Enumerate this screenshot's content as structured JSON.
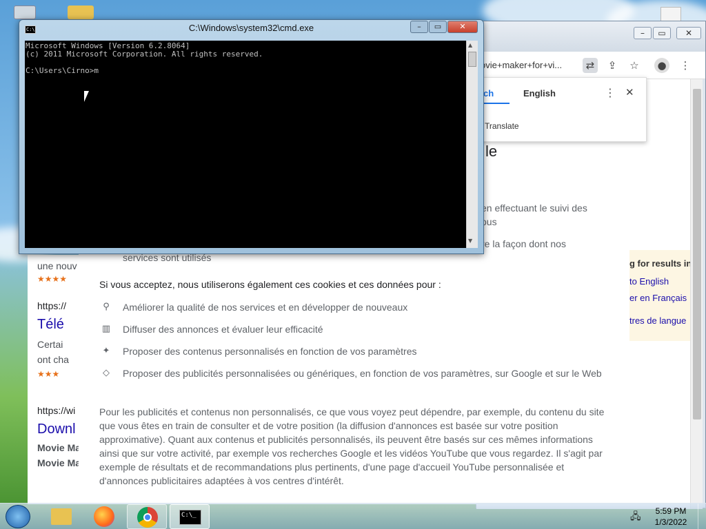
{
  "cmd": {
    "title": "C:\\Windows\\system32\\cmd.exe",
    "icon_text": "C:\\",
    "lines": [
      "Microsoft Windows [Version 6.2.8064]",
      "(c) 2011 Microsoft Corporation. All rights reserved.",
      "",
      "C:\\Users\\Cirno>m"
    ]
  },
  "chrome": {
    "omnibox_text": "ovie+maker+for+vi...",
    "translate_popup": {
      "tab_partial": "ch",
      "tab_active": "English",
      "translate_label": "Translate"
    }
  },
  "background_page": {
    "heading_partial": "le",
    "text_1": "en effectuant le suivi des",
    "text_2": "ous",
    "text_3": "re la façon dont nos",
    "services_line": "services sont utilisés",
    "right_panel": {
      "line_1": "g for results in",
      "line_2": "to English",
      "line_3": "er en Français",
      "line_4": "tres de langue"
    },
    "left_results": {
      "text_1": "une nouv",
      "stars_1": "★★★★",
      "url_1": "https://",
      "title_1": "Télé",
      "text_2": "Certai",
      "text_3": "ont cha",
      "stars_2": "★★★",
      "url_2": "https://wi",
      "title_2": "Downl",
      "bold_1": "Movie Ma",
      "bold_2": "Movie Ma"
    }
  },
  "consent": {
    "intro": "Si vous acceptez, nous utiliserons également ces cookies et ces données pour :",
    "items": [
      {
        "icon": "search-icon",
        "text": "Améliorer la qualité de nos services et en développer de nouveaux"
      },
      {
        "icon": "chart-icon",
        "text": "Diffuser des annonces et évaluer leur efficacité"
      },
      {
        "icon": "sparkle-icon",
        "text": "Proposer des contenus personnalisés en fonction de vos paramètres"
      },
      {
        "icon": "tag-icon",
        "text": "Proposer des publicités personnalisées ou génériques, en fonction de vos paramètres, sur Google et sur le Web"
      }
    ],
    "paragraph": "Pour les publicités et contenus non personnalisés, ce que vous voyez peut dépendre, par exemple, du contenu du site que vous êtes en train de consulter et de votre position (la diffusion d'annonces est basée sur votre position approximative). Quant aux contenus et publicités personnalisés, ils peuvent être basés sur ces mêmes informations ainsi que sur votre activité, par exemple vos recherches Google et les vidéos YouTube que vous regardez. Il s'agit par exemple de résultats et de recommandations plus pertinents, d'une page d'accueil YouTube personnalisée et d'annonces publicitaires adaptées à vos centres d'intérêt."
  },
  "taskbar": {
    "time": "5:59 PM",
    "date": "1/3/2022",
    "cmd_icon_text": "C:\\_"
  }
}
